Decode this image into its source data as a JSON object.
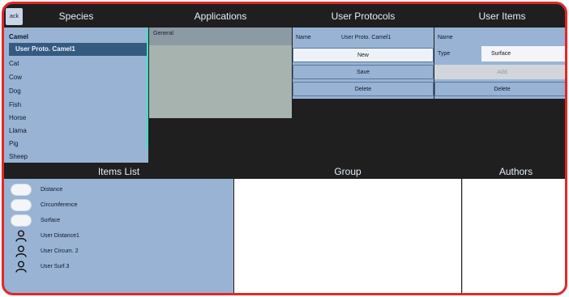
{
  "header": {
    "back": "ack",
    "species": "Species",
    "applications": "Applications",
    "user_protocols": "User Protocols",
    "user_items": "User Items"
  },
  "species": {
    "group": "Camel",
    "selected": "User Proto. Camel1",
    "items": [
      "Cat",
      "Cow",
      "Dog",
      "Fish",
      "Horse",
      "Llama",
      "Pig",
      "Sheep"
    ]
  },
  "applications": {
    "label": "General"
  },
  "protocols": {
    "name_label": "Name",
    "name_value": "User Proto. Camel1",
    "new": "New",
    "save": "Save",
    "delete": "Delete"
  },
  "user_items": {
    "name_label": "Name",
    "type_label": "Type",
    "type_value": "Surface",
    "add": "Add",
    "delete": "Delete"
  },
  "bottom": {
    "items_list": "Items List",
    "group": "Group",
    "authors": "Authors"
  },
  "items_list": [
    {
      "label": "Distance",
      "icon": "toggle"
    },
    {
      "label": "Circumference",
      "icon": "toggle"
    },
    {
      "label": "Surface",
      "icon": "toggle"
    },
    {
      "label": "User Distance1",
      "icon": "user-icon"
    },
    {
      "label": "User Circum. 2",
      "icon": "user-icon"
    },
    {
      "label": "User Surf.3",
      "icon": "user-icon"
    }
  ],
  "colors": {
    "frame_border": "#e0282a",
    "panel": "#98b3d4",
    "selected": "#355a80",
    "background": "#1f1f1f",
    "scroll_accent": "#3fe0c8"
  }
}
